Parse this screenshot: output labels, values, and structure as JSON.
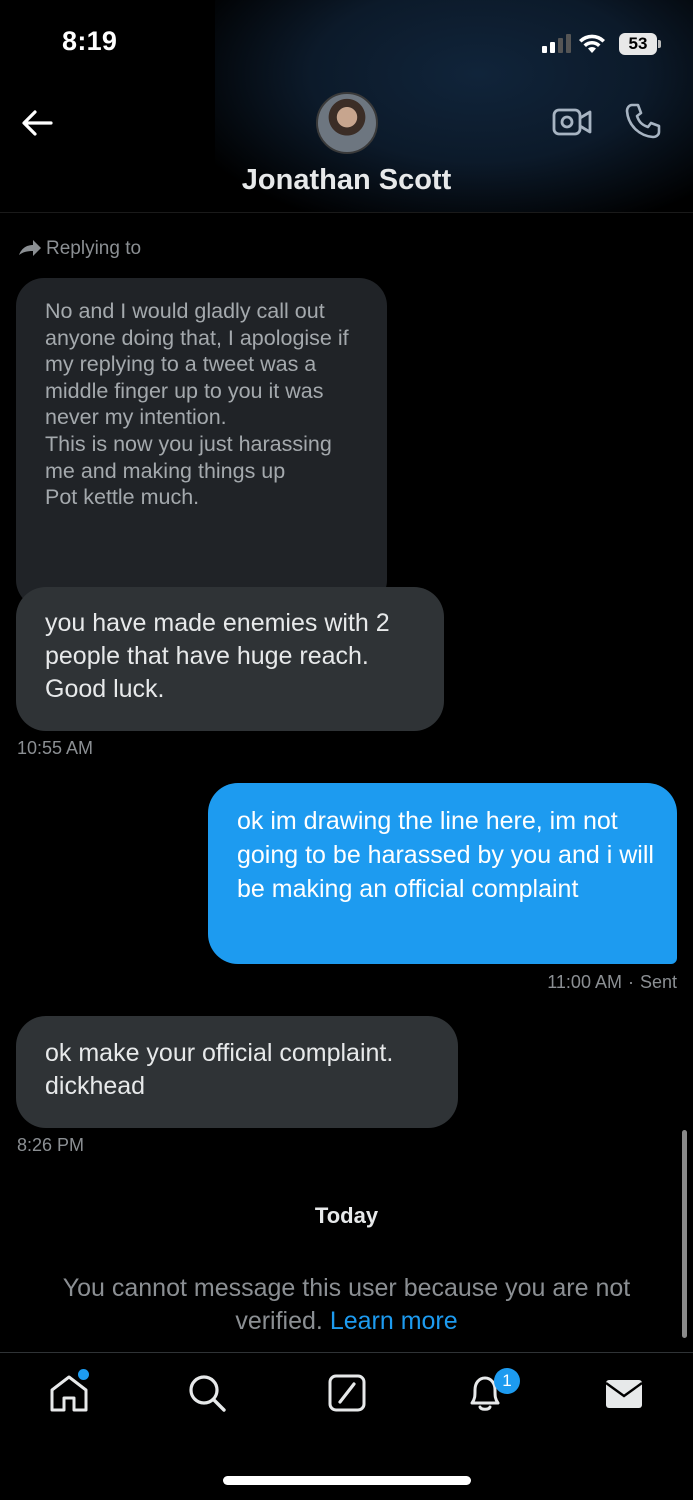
{
  "status_bar": {
    "time": "8:19",
    "battery": "53"
  },
  "header": {
    "name": "Jonathan Scott"
  },
  "conversation": {
    "replying_to": "Replying to",
    "quoted_text": "No and I would gladly call out anyone doing that, I apologise if my replying to a tweet was a middle finger up to you it was never my intention.\nThis is now you just harassing me and making things up\nPot kettle much.",
    "messages": [
      {
        "text": "you have made enemies with 2 people that have huge reach. Good luck.",
        "time": "10:55 AM"
      },
      {
        "text": "ok im drawing the line here, im not going to be harassed by you and i will be making an official complaint",
        "time": "11:00 AM",
        "status": "Sent"
      },
      {
        "text": "ok make your official complaint. dickhead",
        "time": "8:26 PM"
      }
    ],
    "date_separator": "Today",
    "notice": "You cannot message this user because you are not verified.",
    "learn_more": "Learn more"
  },
  "nav": {
    "notifications_badge": "1",
    "items": [
      "home-icon",
      "search-icon",
      "grok-icon",
      "bell-icon",
      "mail-icon"
    ]
  },
  "colors": {
    "accent": "#1d9bf0",
    "bubble_received": "#2f3336",
    "background": "#000000"
  }
}
